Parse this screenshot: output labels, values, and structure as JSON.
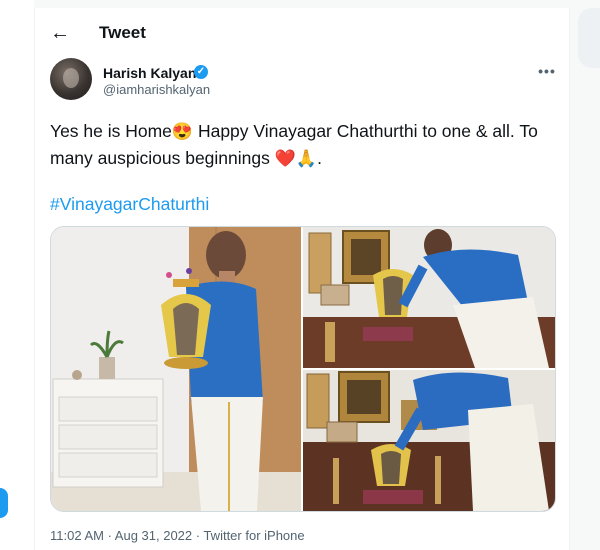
{
  "header": {
    "back_icon": "←",
    "title": "Tweet"
  },
  "author": {
    "display_name": "Harish Kalyan",
    "handle": "@iamharishkalyan",
    "verified_icon": "✓"
  },
  "more_icon": "•••",
  "tweet": {
    "text_part1": "Yes he is Home",
    "emoji1": "😍",
    "text_part2": " Happy Vinayagar Chathurthi to one & all. To many auspicious beginnings ",
    "emoji2": "❤️",
    "emoji3": "🙏",
    "text_part3": ".",
    "hashtag": "#VinayagarChaturthi"
  },
  "meta": {
    "timestamp": "11:02 AM · Aug 31, 2022 · Twitter for iPhone"
  },
  "colors": {
    "accent": "#1d9bf0",
    "text": "#0f1419",
    "secondary": "#536471"
  }
}
